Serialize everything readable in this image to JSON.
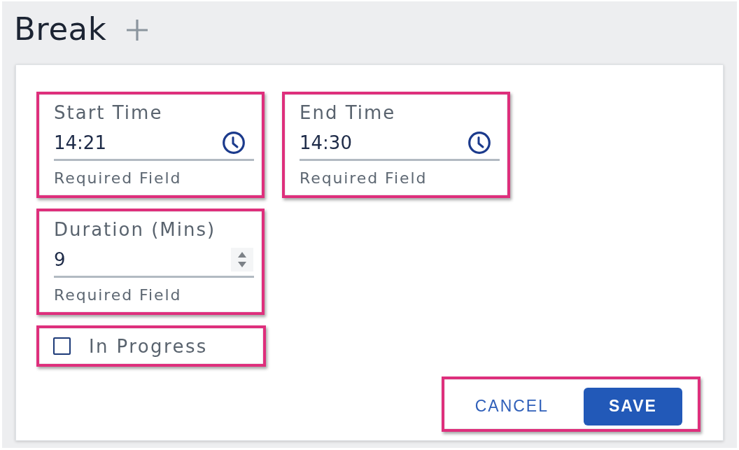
{
  "title": "Break",
  "form": {
    "fields": [
      {
        "kind": "time",
        "label": "Start Time",
        "value": "14:21",
        "helper": "Required Field",
        "highlighted": true
      },
      {
        "kind": "time",
        "label": "End Time",
        "value": "14:30",
        "helper": "Required Field",
        "highlighted": true
      },
      {
        "kind": "number",
        "label": "Duration (Mins)",
        "value": "9",
        "helper": "Required Field",
        "highlighted": true
      }
    ],
    "checkbox": {
      "label": "In Progress",
      "checked": false,
      "highlighted": true
    },
    "actions": {
      "highlighted": true,
      "buttons": [
        {
          "kind": "text",
          "label": "CANCEL"
        },
        {
          "kind": "primary",
          "label": "SAVE"
        }
      ]
    }
  }
}
